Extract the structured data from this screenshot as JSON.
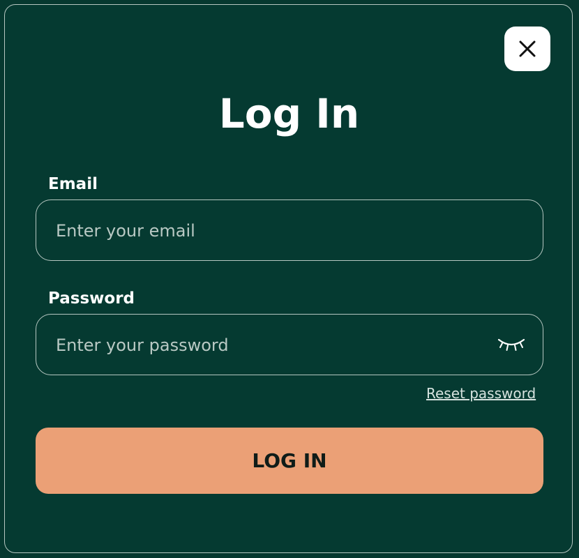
{
  "modal": {
    "title": "Log In",
    "close_icon": "close-icon"
  },
  "email": {
    "label": "Email",
    "placeholder": "Enter your email",
    "value": ""
  },
  "password": {
    "label": "Password",
    "placeholder": "Enter your password",
    "value": "",
    "toggle_icon": "eye-closed-icon"
  },
  "links": {
    "reset_password": "Reset password"
  },
  "actions": {
    "login_label": "LOG IN"
  },
  "colors": {
    "background": "#053a31",
    "accent": "#eba076",
    "border": "#b6c7c1"
  }
}
